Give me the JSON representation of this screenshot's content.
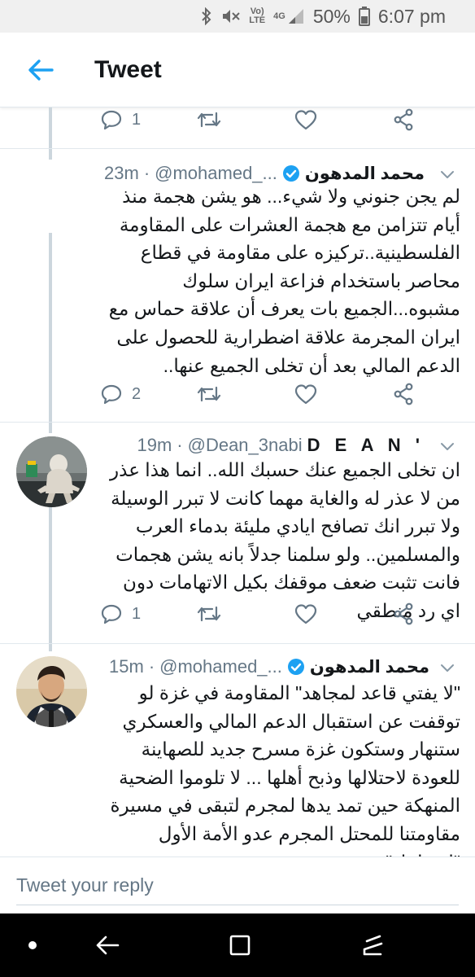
{
  "status_bar": {
    "volte_top": "Vo)",
    "volte_bottom": "LTE",
    "network": "4G",
    "battery": "50%",
    "time": "6:07 pm"
  },
  "header": {
    "title": "Tweet"
  },
  "thread": {
    "top_actions": {
      "reply_count": "1"
    },
    "tweets": [
      {
        "author": "محمد المدهون",
        "handle": "@mohamed_...",
        "time": "23m",
        "text": "لم يجن جنوني ولا شيء... هو يشن هجمة منذ أيام تتزامن مع هجمة العشرات على المقاومة الفلسطينية..تركيزه على مقاومة في قطاع محاصر باستخدام فزاعة ايران سلوك مشبوه...الجميع بات يعرف أن علاقة حماس مع ايران المجرمة علاقة اضطرارية للحصول على الدعم المالي بعد أن تخلى الجميع عنها..",
        "reply_count": "2"
      },
      {
        "author": "D E A N '",
        "handle": "@Dean_3nabi",
        "time": "19m",
        "text": "ان تخلى الجميع عنك حسبك الله.. انما هذا عذر من لا عذر له والغاية مهما كانت لا تبرر الوسيلة ولا تبرر انك تصافح ايادي مليئة بدماء العرب والمسلمين.. ولو سلمنا جدلاً بانه يشن هجمات فانت تثبت ضعف موقفك بكيل الاتهامات دون اي رد منطقي",
        "reply_count": "1"
      },
      {
        "author": "محمد المدهون",
        "handle": "@mohamed_...",
        "time": "15m",
        "text": "\"لا يفتي قاعد لمجاهد\" المقاومة في غزة لو توقفت عن استقبال الدعم المالي والعسكري ستنهار وستكون غزة مسرح جديد للصهاينة للعودة لاحتلالها وذبح أهلها ... لا تلوموا الضحية المنهكة حين تمد يدها لمجرم لتبقى في مسيرة مقاومتنا للمحتل المجرم عدو الأمة الأول \"اسرائيل\""
      }
    ]
  },
  "reply": {
    "placeholder": "Tweet your reply"
  },
  "colors": {
    "accent": "#1da1f2",
    "verified": "#1da1f2",
    "muted": "#657786",
    "thread_line": "#ccd6dd"
  }
}
